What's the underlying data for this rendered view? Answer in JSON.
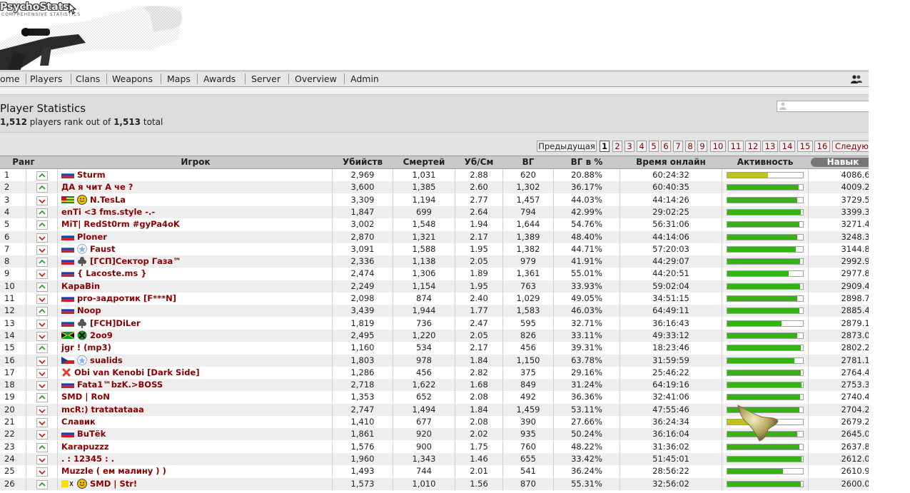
{
  "header": {
    "logo_text": "PsychoStats",
    "logo_sub": "COMPREHENSIVE STATISTICS"
  },
  "nav": {
    "items": [
      "ome",
      "Players",
      "Clans",
      "Weapons",
      "Maps",
      "Awards",
      "Server",
      "Overview",
      "Admin"
    ]
  },
  "titlebar": {
    "title": "Player Statistics",
    "ranked": "1,512",
    "players_rank_out_of": " players rank out of ",
    "total_count": "1,513",
    "total_word": " total"
  },
  "pager": {
    "prev": "Предыдущая",
    "pages": [
      "1",
      "2",
      "3",
      "4",
      "5",
      "6",
      "7",
      "8",
      "9",
      "10",
      "11",
      "12",
      "13",
      "14",
      "15",
      "16"
    ],
    "current": "1",
    "next": "Следующ"
  },
  "table": {
    "columns": [
      "Ранг",
      "Игрок",
      "Убийств",
      "Смертей",
      "Уб/См",
      "ВГ",
      "ВГ в %",
      "Время онлайн",
      "Активность",
      "Навык"
    ],
    "rows": [
      {
        "rank": "1",
        "dir": "up",
        "flag": "ru",
        "badge": "",
        "player": "Sturm",
        "kills": "2,969",
        "deaths": "1,031",
        "kd": "2.88",
        "hs": "620",
        "hsp": "20.88%",
        "time": "60:24:32",
        "act": 0.54,
        "act_color": "yellow",
        "skill": "4086.67"
      },
      {
        "rank": "2",
        "dir": "up",
        "flag": "",
        "badge": "",
        "player": "ДА я чит А че ?",
        "kills": "3,600",
        "deaths": "1,385",
        "kd": "2.60",
        "hs": "1,302",
        "hsp": "36.17%",
        "time": "60:40:35",
        "act": 0.94,
        "act_color": "green",
        "skill": "4009.26"
      },
      {
        "rank": "3",
        "dir": "down",
        "flag": "tg",
        "badge": "smile",
        "player": "N.TesLa",
        "kills": "3,309",
        "deaths": "1,194",
        "kd": "2.77",
        "hs": "1,457",
        "hsp": "44.03%",
        "time": "44:14:26",
        "act": 0.92,
        "act_color": "green",
        "skill": "3729.59"
      },
      {
        "rank": "4",
        "dir": "up",
        "flag": "",
        "badge": "",
        "player": "enTi <3 fms.style -.-",
        "kills": "1,847",
        "deaths": "699",
        "kd": "2.64",
        "hs": "794",
        "hsp": "42.99%",
        "time": "29:02:25",
        "act": 0.97,
        "act_color": "green",
        "skill": "3399.35"
      },
      {
        "rank": "5",
        "dir": "up",
        "flag": "",
        "badge": "",
        "player": "MiT| RedSt0rm #gyPa4oK",
        "kills": "3,002",
        "deaths": "1,548",
        "kd": "1.94",
        "hs": "1,644",
        "hsp": "54.76%",
        "time": "56:31:06",
        "act": 0.95,
        "act_color": "green",
        "skill": "3271.44"
      },
      {
        "rank": "6",
        "dir": "down",
        "flag": "ru",
        "badge": "",
        "player": "Ploner",
        "kills": "2,870",
        "deaths": "1,321",
        "kd": "2.17",
        "hs": "1,389",
        "hsp": "48.40%",
        "time": "44:14:06",
        "act": 0.92,
        "act_color": "green",
        "skill": "3248.37"
      },
      {
        "rank": "7",
        "dir": "down",
        "flag": "ru",
        "badge": "star",
        "player": "Faust",
        "kills": "3,091",
        "deaths": "1,588",
        "kd": "1.95",
        "hs": "1,382",
        "hsp": "44.71%",
        "time": "57:20:03",
        "act": 0.91,
        "act_color": "green",
        "skill": "3144.80"
      },
      {
        "rank": "8",
        "dir": "up",
        "flag": "ru",
        "badge": "club",
        "player": "[ГСП]Сектор Газа™",
        "kills": "2,336",
        "deaths": "1,138",
        "kd": "2.05",
        "hs": "979",
        "hsp": "41.91%",
        "time": "44:29:07",
        "act": 0.96,
        "act_color": "green",
        "skill": "2992.96"
      },
      {
        "rank": "9",
        "dir": "down",
        "flag": "ru",
        "badge": "",
        "player": "{ Lacoste.ms }",
        "kills": "2,474",
        "deaths": "1,306",
        "kd": "1.89",
        "hs": "1,361",
        "hsp": "55.01%",
        "time": "44:20:51",
        "act": 0.81,
        "act_color": "green",
        "skill": "2977.87"
      },
      {
        "rank": "10",
        "dir": "up",
        "flag": "",
        "badge": "",
        "player": "КараВin",
        "kills": "2,249",
        "deaths": "1,154",
        "kd": "1.95",
        "hs": "763",
        "hsp": "33.93%",
        "time": "59:02:04",
        "act": 0.96,
        "act_color": "green",
        "skill": "2909.44"
      },
      {
        "rank": "11",
        "dir": "down",
        "flag": "ru",
        "badge": "",
        "player": "pro-задротик [F***N]",
        "kills": "2,098",
        "deaths": "874",
        "kd": "2.40",
        "hs": "1,029",
        "hsp": "49.05%",
        "time": "34:51:15",
        "act": 0.92,
        "act_color": "green",
        "skill": "2898.71"
      },
      {
        "rank": "12",
        "dir": "up",
        "flag": "ru",
        "badge": "",
        "player": "Noop",
        "kills": "3,439",
        "deaths": "1,944",
        "kd": "1.77",
        "hs": "1,583",
        "hsp": "46.03%",
        "time": "64:49:11",
        "act": 0.95,
        "act_color": "green",
        "skill": "2885.42"
      },
      {
        "rank": "13",
        "dir": "down",
        "flag": "ru",
        "badge": "club",
        "player": "[FCH]DiLer",
        "kills": "1,819",
        "deaths": "736",
        "kd": "2.47",
        "hs": "595",
        "hsp": "32.71%",
        "time": "36:16:43",
        "act": 0.72,
        "act_color": "green",
        "skill": "2879.16"
      },
      {
        "rank": "14",
        "dir": "down",
        "flag": "jm",
        "badge": "xbox",
        "player": "2oo9",
        "kills": "2,495",
        "deaths": "1,220",
        "kd": "2.05",
        "hs": "826",
        "hsp": "33.11%",
        "time": "49:33:12",
        "act": 0.92,
        "act_color": "green",
        "skill": "2873.00"
      },
      {
        "rank": "15",
        "dir": "up",
        "flag": "",
        "badge": "",
        "player": "jgr ! (mp3)",
        "kills": "1,160",
        "deaths": "534",
        "kd": "2.17",
        "hs": "456",
        "hsp": "39.31%",
        "time": "18:23:46",
        "act": 0.97,
        "act_color": "green",
        "skill": "2802.22"
      },
      {
        "rank": "16",
        "dir": "down",
        "flag": "cz",
        "badge": "star",
        "player": "sualids",
        "kills": "1,803",
        "deaths": "978",
        "kd": "1.84",
        "hs": "1,150",
        "hsp": "63.78%",
        "time": "31:59:59",
        "act": 0.89,
        "act_color": "green",
        "skill": "2781.12"
      },
      {
        "rank": "17",
        "dir": "down",
        "flag": "",
        "badge": "x",
        "player": "Obi van Kenobi [Dark Side]",
        "kills": "1,286",
        "deaths": "456",
        "kd": "2.82",
        "hs": "375",
        "hsp": "29.16%",
        "time": "25:46:22",
        "act": 0.97,
        "act_color": "green",
        "skill": "2764.43"
      },
      {
        "rank": "18",
        "dir": "down",
        "flag": "ru",
        "badge": "",
        "player": "Fata1™bzK.>BOSS",
        "kills": "2,718",
        "deaths": "1,622",
        "kd": "1.68",
        "hs": "849",
        "hsp": "31.24%",
        "time": "64:19:16",
        "act": 0.98,
        "act_color": "green",
        "skill": "2753.36"
      },
      {
        "rank": "19",
        "dir": "up",
        "flag": "",
        "badge": "",
        "player": "SMD | RoN",
        "kills": "1,353",
        "deaths": "652",
        "kd": "2.08",
        "hs": "492",
        "hsp": "36.36%",
        "time": "32:41:06",
        "act": 0.96,
        "act_color": "green",
        "skill": "2740.46"
      },
      {
        "rank": "20",
        "dir": "down",
        "flag": "",
        "badge": "",
        "player": "mcR:) tratatataaa",
        "kills": "2,747",
        "deaths": "1,494",
        "kd": "1.84",
        "hs": "1,459",
        "hsp": "53.11%",
        "time": "47:55:46",
        "act": 0.95,
        "act_color": "green",
        "skill": "2704.20"
      },
      {
        "rank": "21",
        "dir": "down",
        "flag": "",
        "badge": "",
        "player": "Славик",
        "kills": "1,410",
        "deaths": "677",
        "kd": "2.08",
        "hs": "390",
        "hsp": "27.66%",
        "time": "36:24:34",
        "act": 0.58,
        "act_color": "yellow",
        "skill": "2679.20"
      },
      {
        "rank": "22",
        "dir": "down",
        "flag": "ru",
        "badge": "",
        "player": "BuTёk",
        "kills": "1,861",
        "deaths": "920",
        "kd": "2.02",
        "hs": "935",
        "hsp": "50.24%",
        "time": "36:16:04",
        "act": 0.92,
        "act_color": "green",
        "skill": "2645.04"
      },
      {
        "rank": "23",
        "dir": "up",
        "flag": "",
        "badge": "",
        "player": "Karapuzzz",
        "kills": "1,576",
        "deaths": "900",
        "kd": "1.75",
        "hs": "760",
        "hsp": "48.22%",
        "time": "31:36:02",
        "act": 0.95,
        "act_color": "green",
        "skill": "2637.88"
      },
      {
        "rank": "24",
        "dir": "down",
        "flag": "",
        "badge": "",
        "player": ". : 12345 : .",
        "kills": "1,960",
        "deaths": "1,343",
        "kd": "1.46",
        "hs": "655",
        "hsp": "33.42%",
        "time": "51:45:01",
        "act": 0.98,
        "act_color": "green",
        "skill": "2612.01"
      },
      {
        "rank": "25",
        "dir": "down",
        "flag": "",
        "badge": "",
        "player": "Muzzle ( ем малину ) )",
        "kills": "1,493",
        "deaths": "744",
        "kd": "2.01",
        "hs": "541",
        "hsp": "36.24%",
        "time": "28:56:22",
        "act": 0.74,
        "act_color": "green",
        "skill": "2610.95"
      },
      {
        "rank": "26",
        "dir": "up",
        "flag": "yl",
        "badge": "smile",
        "player": "SMD | Str!",
        "kills": "1,573",
        "deaths": "1,010",
        "kd": "1.56",
        "hs": "870",
        "hsp": "55.31%",
        "time": "32:56:02",
        "act": 0.97,
        "act_color": "green",
        "skill": "2600.02"
      }
    ]
  },
  "colors": {
    "player_name": "#8b0000",
    "activity_green": "#33b411",
    "activity_yellow": "#c4c020",
    "arrow_up": "#2e9b2e",
    "arrow_down": "#cc2222"
  }
}
